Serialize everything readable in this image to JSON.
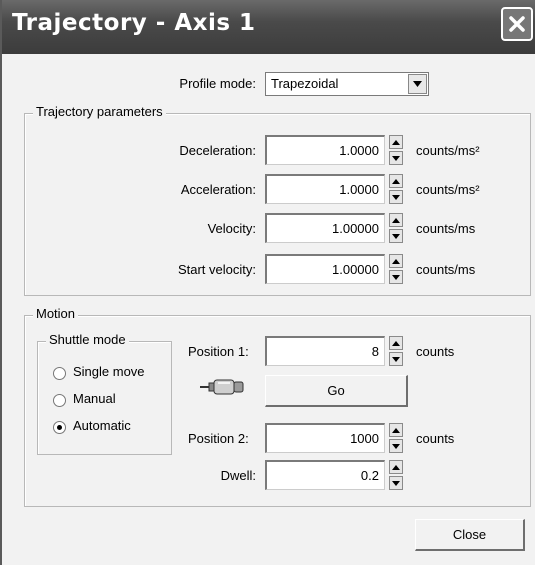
{
  "window": {
    "title": "Trajectory - Axis 1"
  },
  "profile": {
    "label": "Profile mode:",
    "value": "Trapezoidal"
  },
  "trajectory": {
    "legend": "Trajectory parameters",
    "rows": [
      {
        "label": "Deceleration:",
        "value": "1.0000",
        "unit": "counts/ms²"
      },
      {
        "label": "Acceleration:",
        "value": "1.0000",
        "unit": "counts/ms²"
      },
      {
        "label": "Velocity:",
        "value": "1.00000",
        "unit": "counts/ms"
      },
      {
        "label": "Start velocity:",
        "value": "1.00000",
        "unit": "counts/ms"
      }
    ]
  },
  "motion": {
    "legend": "Motion",
    "shuttle": {
      "legend": "Shuttle mode",
      "options": [
        {
          "label": "Single move",
          "selected": false
        },
        {
          "label": "Manual",
          "selected": false
        },
        {
          "label": "Automatic",
          "selected": true
        }
      ]
    },
    "position1": {
      "label": "Position 1:",
      "value": "8",
      "unit": "counts"
    },
    "go_label": "Go",
    "position2": {
      "label": "Position 2:",
      "value": "1000",
      "unit": "counts"
    },
    "dwell": {
      "label": "Dwell:",
      "value": "0.2"
    }
  },
  "close_label": "Close",
  "icons": {
    "close": "close-x-icon",
    "dropdown": "chevron-down-icon",
    "motor": "motor-icon"
  }
}
